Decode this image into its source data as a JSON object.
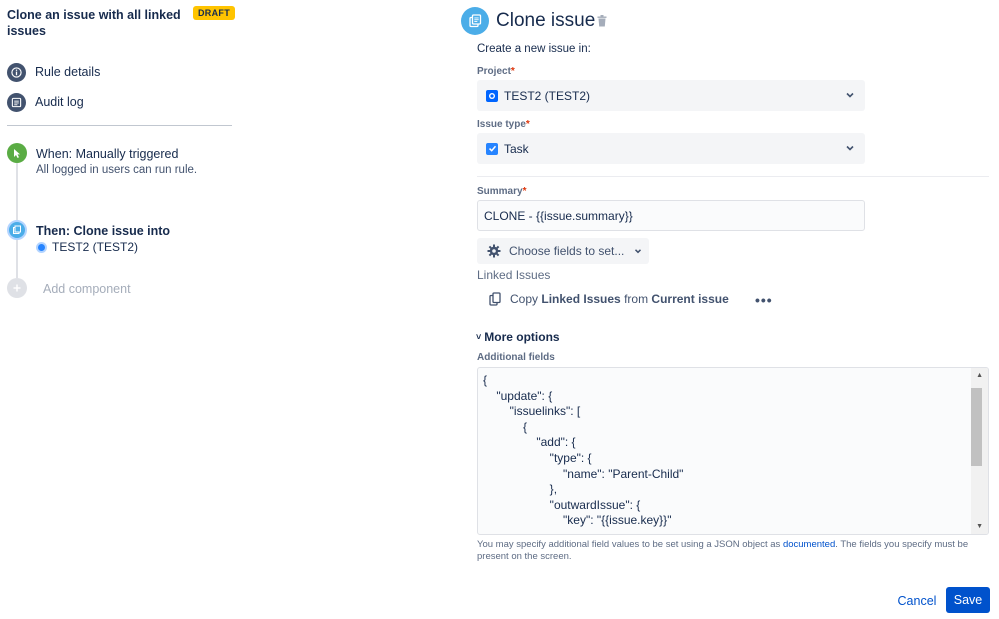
{
  "sidebar": {
    "rule_title": "Clone an issue with all linked issues",
    "draft_badge": "DRAFT",
    "nav": [
      {
        "label": "Rule details",
        "icon": "info-icon"
      },
      {
        "label": "Audit log",
        "icon": "list-icon"
      }
    ],
    "trigger": {
      "title": "When: Manually triggered",
      "subtitle": "All logged in users can run rule.",
      "icon": "cursor-icon",
      "color": "#5aac44"
    },
    "action": {
      "title": "Then: Clone issue into",
      "project": "TEST2 (TEST2)",
      "icon": "clone-icon",
      "color": "#4bade8"
    },
    "add_component": "Add component"
  },
  "main": {
    "title": "Clone issue",
    "create_label": "Create a new issue in:",
    "project": {
      "label": "Project",
      "required_mark": "*",
      "value": "TEST2 (TEST2)"
    },
    "issue_type": {
      "label": "Issue type",
      "required_mark": "*",
      "value": "Task"
    },
    "summary": {
      "label": "Summary",
      "required_mark": "*",
      "value": "CLONE - {{issue.summary}}"
    },
    "choose_fields": "Choose fields to set...",
    "linked_issues": {
      "label": "Linked Issues",
      "copy": "Copy",
      "what": "Linked Issues",
      "from": "from",
      "source": "Current issue",
      "more": "•••"
    },
    "more_options": "More options",
    "additional_fields": {
      "label": "Additional fields",
      "code": "{\n    \"update\": {\n        \"issuelinks\": [\n            {\n                \"add\": {\n                    \"type\": {\n                        \"name\": \"Parent-Child\"\n                    },\n                    \"outwardIssue\": {\n                        \"key\": \"{{issue.key}}\""
    },
    "help": {
      "before": "You may specify additional field values to be set using a JSON object as ",
      "link": "documented",
      "after": ". The fields you specify must be present on the screen."
    }
  },
  "footer": {
    "cancel": "Cancel",
    "save": "Save"
  },
  "colors": {
    "primary": "#0052cc",
    "draft": "#ffc400",
    "required": "#de350b"
  }
}
